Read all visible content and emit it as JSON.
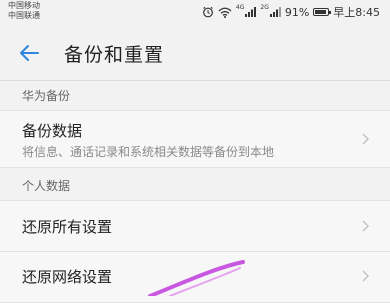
{
  "status_bar": {
    "carrier_1": "中国移动",
    "carrier_2": "中国联通",
    "network_1": "4G",
    "network_2": "2G",
    "battery_text": "91%",
    "battery_level": 0.91,
    "time": "早上8:45"
  },
  "app_bar": {
    "title": "备份和重置"
  },
  "sections": {
    "huawei_backup": {
      "header": "华为备份",
      "backup_data": {
        "title": "备份数据",
        "subtitle": "将信息、通话记录和系统相关数据等备份到本地"
      }
    },
    "personal_data": {
      "header": "个人数据",
      "restore_all": {
        "title": "还原所有设置"
      },
      "restore_network": {
        "title": "还原网络设置"
      }
    }
  },
  "colors": {
    "accent": "#2e86de",
    "annotation": "#c03cdc",
    "background": "#f2f2f2"
  }
}
